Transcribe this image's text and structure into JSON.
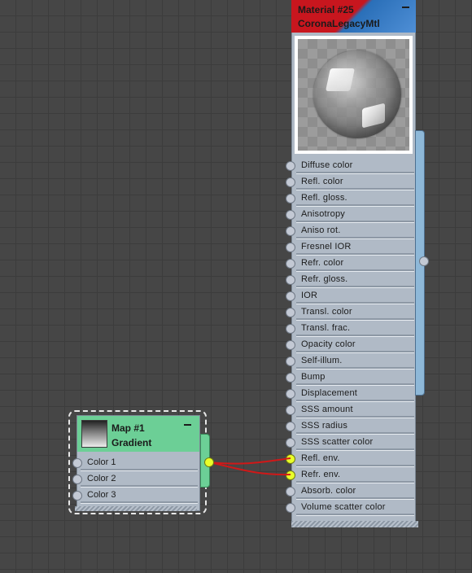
{
  "material_node": {
    "title": "Material #25",
    "subtitle": "CoronaLegacyMtl",
    "collapse_icon": "minus-icon",
    "sockets": [
      {
        "label": "Diffuse color",
        "connected": false
      },
      {
        "label": "Refl. color",
        "connected": false
      },
      {
        "label": "Refl. gloss.",
        "connected": false
      },
      {
        "label": "Anisotropy",
        "connected": false
      },
      {
        "label": "Aniso rot.",
        "connected": false
      },
      {
        "label": "Fresnel IOR",
        "connected": false
      },
      {
        "label": "Refr. color",
        "connected": false
      },
      {
        "label": "Refr. gloss.",
        "connected": false
      },
      {
        "label": "IOR",
        "connected": false
      },
      {
        "label": "Transl. color",
        "connected": false
      },
      {
        "label": "Transl. frac.",
        "connected": false
      },
      {
        "label": "Opacity color",
        "connected": false
      },
      {
        "label": "Self-illum.",
        "connected": false
      },
      {
        "label": "Bump",
        "connected": false
      },
      {
        "label": "Displacement",
        "connected": false
      },
      {
        "label": "SSS amount",
        "connected": false
      },
      {
        "label": "SSS radius",
        "connected": false
      },
      {
        "label": "SSS scatter color",
        "connected": false
      },
      {
        "label": "Refl. env.",
        "connected": true
      },
      {
        "label": "Refr. env.",
        "connected": true
      },
      {
        "label": "Absorb. color",
        "connected": false
      },
      {
        "label": "Volume scatter color",
        "connected": false
      }
    ]
  },
  "gradient_node": {
    "title": "Map #1",
    "subtitle": "Gradient",
    "collapse_icon": "minus-icon",
    "sockets": [
      {
        "label": "Color 1"
      },
      {
        "label": "Color 2"
      },
      {
        "label": "Color 3"
      }
    ]
  },
  "colors": {
    "canvas": "#464646",
    "grid": "#3c3c3c",
    "node_body": "#b0bac6",
    "material_header_red": "#c8161e",
    "material_header_blue": "#2a6fb8",
    "gradient_header": "#6ccf96",
    "active_socket": "#e9ff2a",
    "wire": "#d01818"
  }
}
